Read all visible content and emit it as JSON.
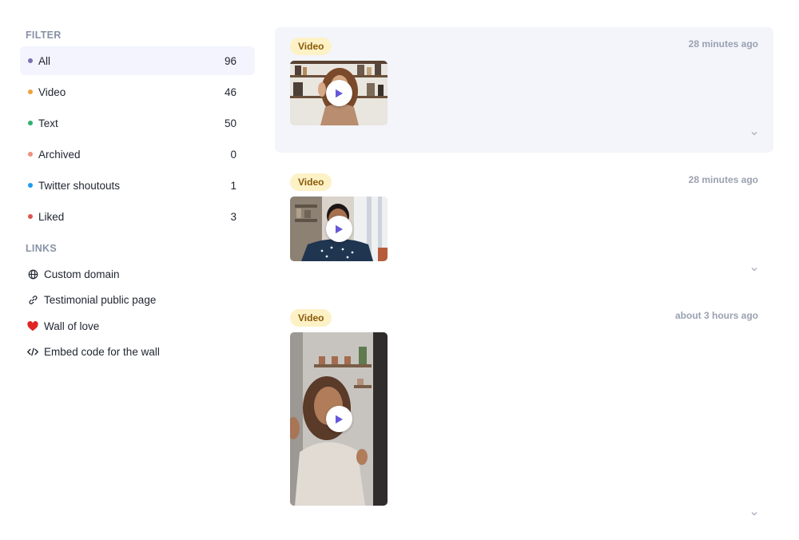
{
  "sidebar": {
    "filter_title": "FILTER",
    "filters": [
      {
        "label": "All",
        "count": "96",
        "dot_color": "#7c6fb2",
        "active": true
      },
      {
        "label": "Video",
        "count": "46",
        "dot_color": "#f0a23b"
      },
      {
        "label": "Text",
        "count": "50",
        "dot_color": "#2fb16b"
      },
      {
        "label": "Archived",
        "count": "0",
        "dot_color": "#ee8f7d"
      },
      {
        "label": "Twitter shoutouts",
        "count": "1",
        "dot_color": "#1d9bf0"
      },
      {
        "label": "Liked",
        "count": "3",
        "dot_color": "#e0544d"
      }
    ],
    "links_title": "LINKS",
    "links": [
      {
        "label": "Custom domain",
        "icon": "globe-icon"
      },
      {
        "label": "Testimonial public page",
        "icon": "link-icon"
      },
      {
        "label": "Wall of love",
        "icon": "heart-icon"
      },
      {
        "label": "Embed code for the wall",
        "icon": "code-icon"
      }
    ]
  },
  "feed": {
    "items": [
      {
        "type_label": "Video",
        "time": "28 minutes ago",
        "highlighted": true
      },
      {
        "type_label": "Video",
        "time": "28 minutes ago",
        "highlighted": false
      },
      {
        "type_label": "Video",
        "time": "about 3 hours ago",
        "highlighted": false
      }
    ]
  },
  "colors": {
    "accent": "#6557d8",
    "badge_bg": "#fdf1c6",
    "badge_text": "#8a5a08",
    "highlight_bg": "#f3f5fa",
    "heart": "#e02424"
  }
}
